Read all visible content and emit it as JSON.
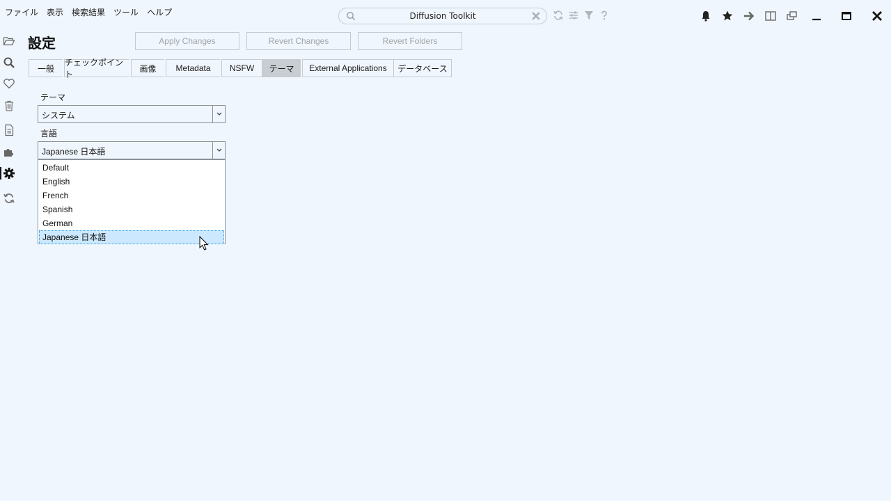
{
  "menu": [
    "ファイル",
    "表示",
    "検索結果",
    "ツール",
    "ヘルプ"
  ],
  "search": {
    "value": "Diffusion Toolkit"
  },
  "page_title": "設定",
  "actions": {
    "apply": "Apply Changes",
    "revert": "Revert Changes",
    "revert_folders": "Revert Folders"
  },
  "tabs": [
    "一般",
    "チェックポイント",
    "画像",
    "Metadata",
    "NSFW",
    "テーマ",
    "External Applications",
    "データベース"
  ],
  "active_tab": "テーマ",
  "theme": {
    "label": "テーマ",
    "value": "システム"
  },
  "language": {
    "label": "言語",
    "value": "Japanese 日本語",
    "options": [
      "Default",
      "English",
      "French",
      "Spanish",
      "German",
      "Japanese 日本語"
    ]
  }
}
